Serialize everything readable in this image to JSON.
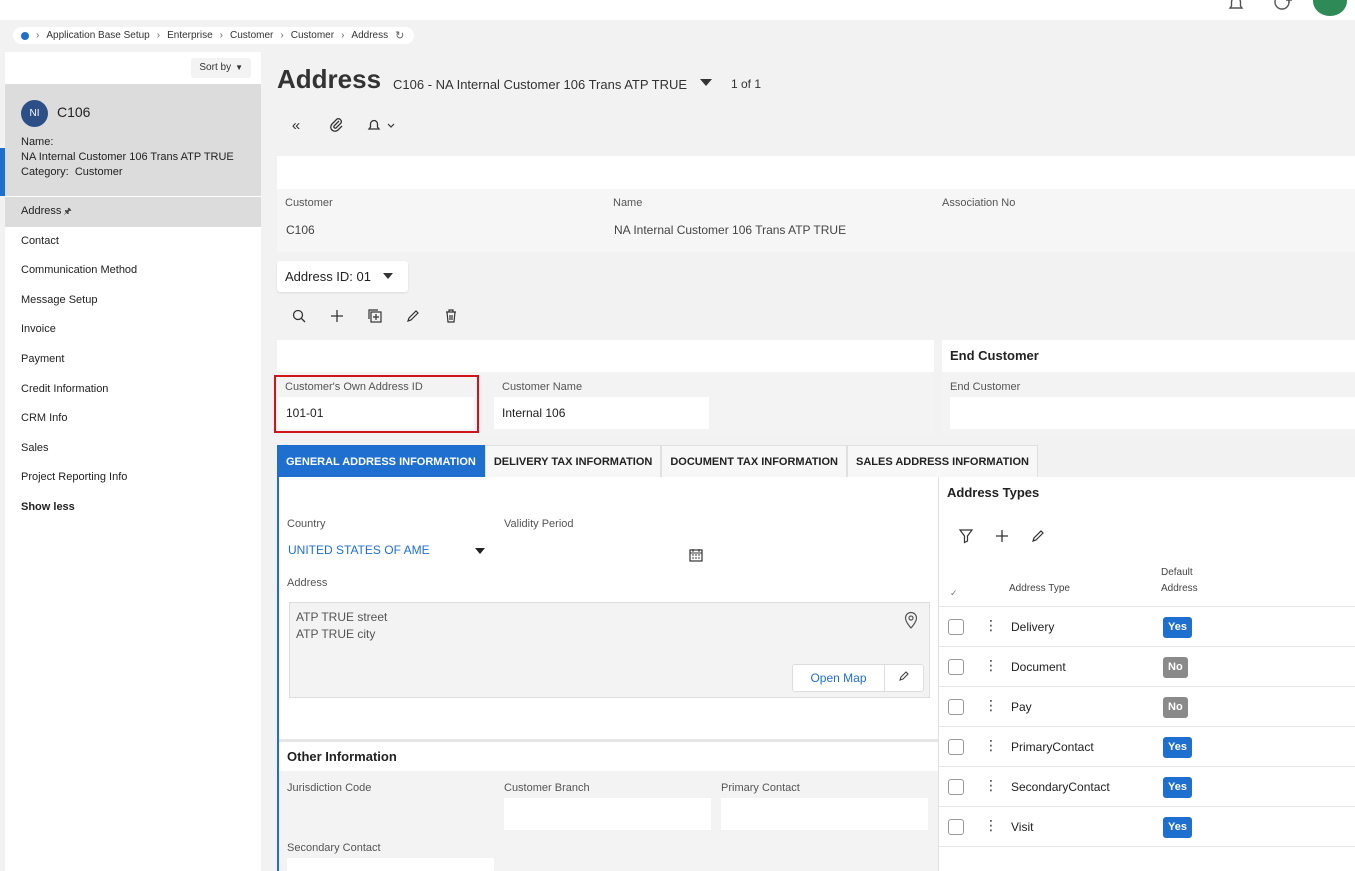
{
  "breadcrumb": [
    "Application Base Setup",
    "Enterprise",
    "Customer",
    "Customer",
    "Address"
  ],
  "sort": {
    "label": "Sort by"
  },
  "record": {
    "initials": "NI",
    "id": "C106",
    "name_label": "Name:",
    "name_value": "NA Internal Customer 106 Trans ATP TRUE",
    "category_label": "Category:",
    "category_value": "Customer"
  },
  "nav": [
    {
      "label": "Address"
    },
    {
      "label": "Contact"
    },
    {
      "label": "Communication Method"
    },
    {
      "label": "Message Setup"
    },
    {
      "label": "Invoice"
    },
    {
      "label": "Payment"
    },
    {
      "label": "Credit Information"
    },
    {
      "label": "CRM Info"
    },
    {
      "label": "Sales"
    },
    {
      "label": "Project Reporting Info"
    },
    {
      "label": "Show less"
    }
  ],
  "page": {
    "title": "Address",
    "record_selector": "C106 - NA Internal Customer 106 Trans ATP TRUE",
    "record_count": "1 of 1"
  },
  "header": {
    "customer_label": "Customer",
    "customer_value": "C106",
    "name_label": "Name",
    "name_value": "NA Internal Customer 106 Trans ATP TRUE",
    "association_label": "Association No",
    "association_value": ""
  },
  "address_id": "Address ID: 01",
  "own": {
    "own_id_label": "Customer's Own Address ID",
    "own_id_value": "101-01",
    "customer_name_label": "Customer Name",
    "customer_name_value": "Internal 106"
  },
  "end_customer": {
    "title": "End Customer",
    "label": "End Customer",
    "value": ""
  },
  "tabs": [
    {
      "label": "GENERAL ADDRESS INFORMATION"
    },
    {
      "label": "DELIVERY TAX INFORMATION"
    },
    {
      "label": "DOCUMENT TAX INFORMATION"
    },
    {
      "label": "SALES ADDRESS INFORMATION"
    }
  ],
  "general": {
    "country_label": "Country",
    "country_value": "UNITED STATES OF AME",
    "validity_label": "Validity Period",
    "address_label": "Address",
    "address_line1": "ATP TRUE street",
    "address_line2": "ATP TRUE city",
    "open_map": "Open Map"
  },
  "other": {
    "title": "Other Information",
    "jurisdiction_label": "Jurisdiction Code",
    "branch_label": "Customer Branch",
    "primary_label": "Primary Contact",
    "secondary_label": "Secondary Contact"
  },
  "address_types": {
    "title": "Address Types",
    "col_type": "Address Type",
    "col_default_1": "Default",
    "col_default_2": "Address",
    "rows": [
      {
        "type": "Delivery",
        "default": "Yes"
      },
      {
        "type": "Document",
        "default": "No"
      },
      {
        "type": "Pay",
        "default": "No"
      },
      {
        "type": "PrimaryContact",
        "default": "Yes"
      },
      {
        "type": "SecondaryContact",
        "default": "Yes"
      },
      {
        "type": "Visit",
        "default": "Yes"
      }
    ]
  },
  "colors": {
    "accent": "#1f6fd1",
    "highlight_border": "#d0141b",
    "badge_no": "#8a8a8a"
  },
  "icons": [
    "bell-icon",
    "help-icon",
    "refresh-icon",
    "collapse-icon",
    "attachment-icon",
    "notification-icon",
    "search-icon",
    "add-icon",
    "duplicate-icon",
    "edit-icon",
    "delete-icon",
    "calendar-icon",
    "location-pin-icon",
    "filter-icon",
    "kebab-icon",
    "pin-icon"
  ]
}
